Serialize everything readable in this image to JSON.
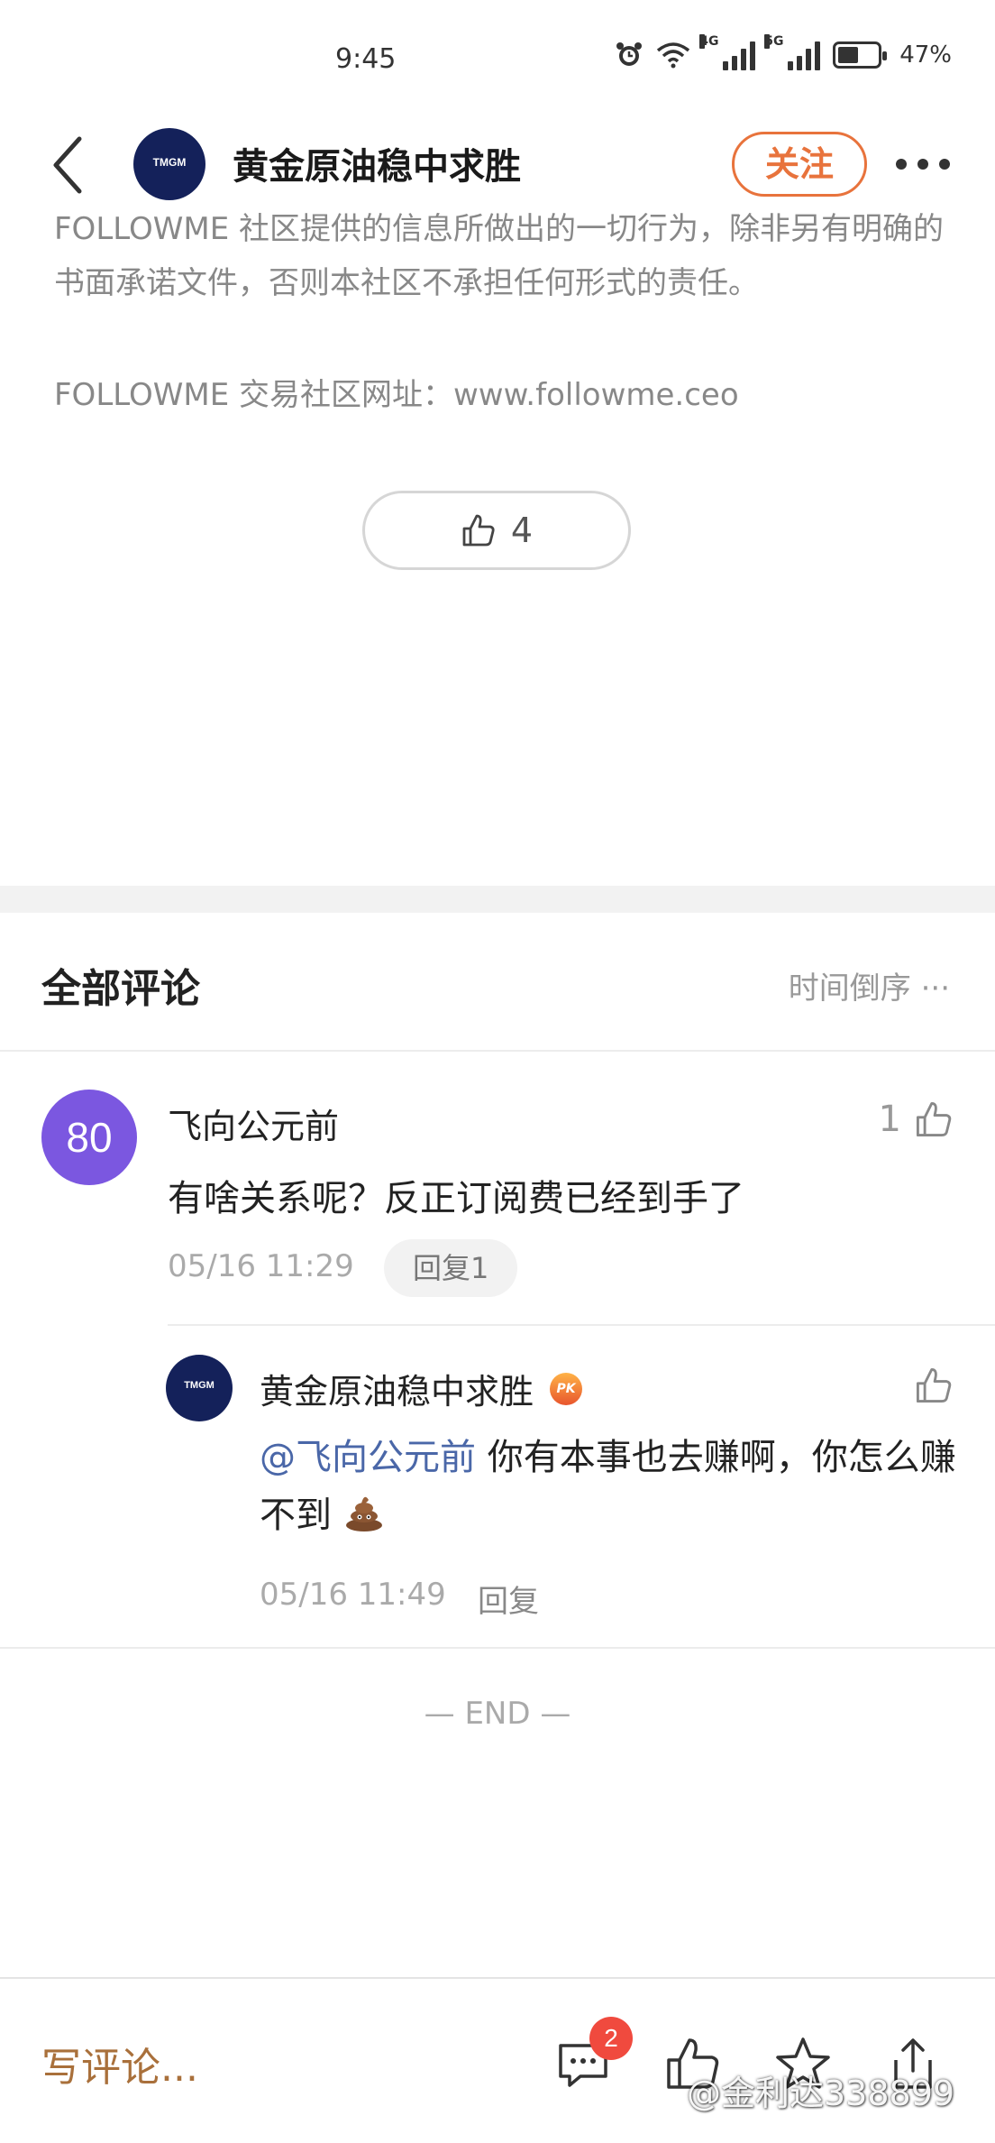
{
  "status_bar": {
    "time": "9:45",
    "network_a": "4G",
    "network_b": "5G",
    "battery": "47%"
  },
  "header": {
    "title": "黄金原油稳中求胜",
    "avatar_logo": "TMGM",
    "follow_label": "关注"
  },
  "article": {
    "disclaimer": "FOLLOWME 社区提供的信息所做出的一切行为，除非另有明确的书面承诺文件，否则本社区不承担任何形式的责任。",
    "site_line": "FOLLOWME 交易社区网址：www.followme.ceo",
    "like_count": "4"
  },
  "comments": {
    "title": "全部评论",
    "sort_label": "时间倒序 ···",
    "items": [
      {
        "avatar_text": "80",
        "user": "飞向公元前",
        "likes": "1",
        "text": "有啥关系呢？反正订阅费已经到手了",
        "time": "05/16 11:29",
        "reply_label": "回复1",
        "replies": [
          {
            "user": "黄金原油稳中求胜",
            "badge": "PK",
            "mention": "@飞向公元前",
            "text": " 你有本事也去赚啊，你怎么赚不到",
            "time": "05/16 11:49",
            "reply_label": "回复"
          }
        ]
      }
    ],
    "end_text": "— END —"
  },
  "bottom_bar": {
    "write_placeholder": "写评论...",
    "comment_badge": "2",
    "watermark": "@金利达338899"
  },
  "colors": {
    "accent_orange": "#e8733c",
    "write_brown": "#a9703b",
    "mention_blue": "#4a67a8",
    "avatar_purple": "#7b57e0",
    "badge_red": "#f04a3e"
  }
}
